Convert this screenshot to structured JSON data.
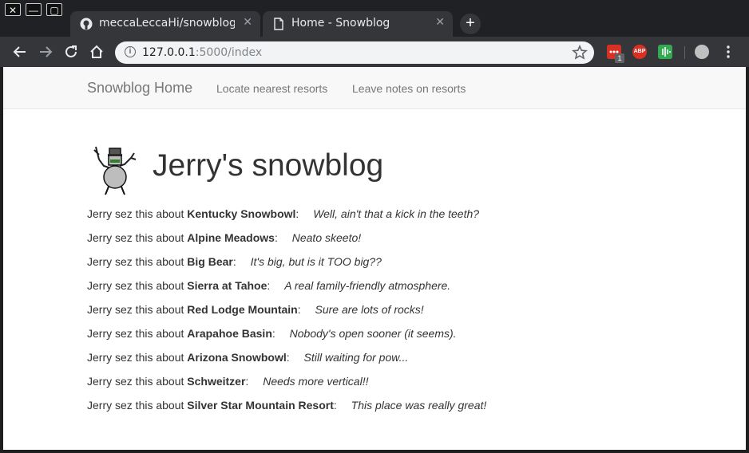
{
  "window": {
    "close_glyph": "✕",
    "minimize_glyph": "—",
    "maximize_glyph": "▢"
  },
  "tabs": [
    {
      "title": "meccaLeccaHi/snowblog",
      "icon": "github-icon",
      "active": false
    },
    {
      "title": "Home - Snowblog",
      "icon": "page-icon",
      "active": true
    }
  ],
  "tab_close_glyph": "✕",
  "new_tab_glyph": "+",
  "address_bar": {
    "host": "127.0.0.1",
    "rest": ":5000/index"
  },
  "extensions": {
    "badge_count": "1",
    "abp_label": "ABP"
  },
  "navbar": {
    "brand": "Snowblog Home",
    "links": [
      "Locate nearest resorts",
      "Leave notes on resorts"
    ]
  },
  "blog": {
    "title": "Jerry's snowblog",
    "prefix": "Jerry sez this about",
    "entries": [
      {
        "resort": "Kentucky Snowbowl",
        "note": "Well, ain't that a kick in the teeth?"
      },
      {
        "resort": "Alpine Meadows",
        "note": "Neato skeeto!"
      },
      {
        "resort": "Big Bear",
        "note": "It's big, but is it TOO big??"
      },
      {
        "resort": "Sierra at Tahoe",
        "note": "A real family-friendly atmosphere."
      },
      {
        "resort": "Red Lodge Mountain",
        "note": "Sure are lots of rocks!"
      },
      {
        "resort": "Arapahoe Basin",
        "note": "Nobody's open sooner (it seems)."
      },
      {
        "resort": "Arizona Snowbowl",
        "note": "Still waiting for pow..."
      },
      {
        "resort": "Schweitzer",
        "note": "Needs more vertical!!"
      },
      {
        "resort": "Silver Star Mountain Resort",
        "note": "This place was really great!"
      }
    ]
  },
  "colors": {
    "chrome_dark": "#202124",
    "tab_bg": "#35363a",
    "navbar_bg": "#f8f8f8",
    "text": "#333333"
  }
}
